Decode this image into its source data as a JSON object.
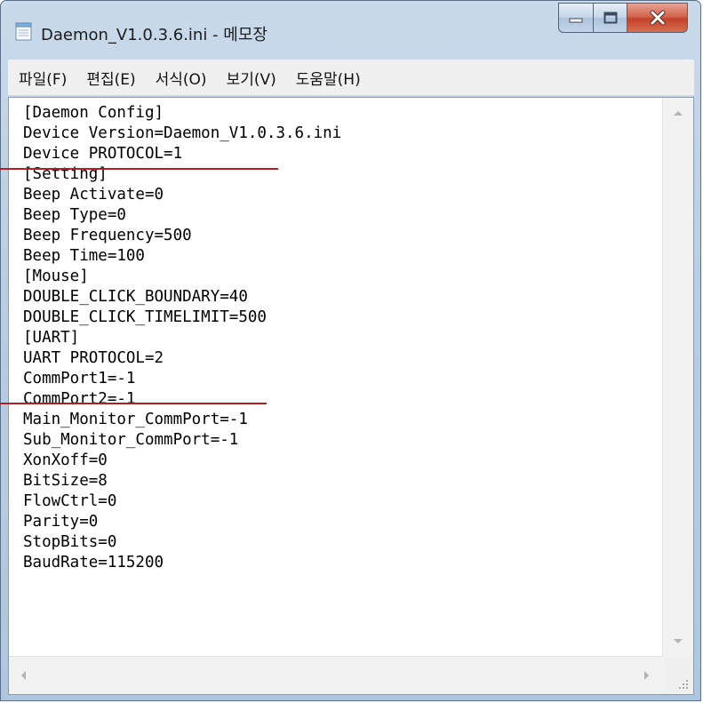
{
  "window": {
    "title": "Daemon_V1.0.3.6.ini - 메모장",
    "app_icon": "notepad-icon",
    "buttons": {
      "minimize": "minimize-icon",
      "maximize": "maximize-icon",
      "close": "close-icon"
    }
  },
  "menu": [
    {
      "label": "파일(F)"
    },
    {
      "label": "편집(E)"
    },
    {
      "label": "서식(O)"
    },
    {
      "label": "보기(V)"
    },
    {
      "label": "도움말(H)"
    }
  ],
  "content": {
    "lines": [
      "[Daemon Config]",
      "Device Version=Daemon_V1.0.3.6.ini",
      "Device PROTOCOL=1",
      "[Setting]",
      "Beep Activate=0",
      "Beep Type=0",
      "Beep Frequency=500",
      "Beep Time=100",
      "[Mouse]",
      "DOUBLE_CLICK_BOUNDARY=40",
      "DOUBLE_CLICK_TIMELIMIT=500",
      "[UART]",
      "UART PROTOCOL=2",
      "CommPort1=-1",
      "CommPort2=-1",
      "Main_Monitor_CommPort=-1",
      "Sub_Monitor_CommPort=-1",
      "XonXoff=0",
      "BitSize=8",
      "FlowCtrl=0",
      "Parity=0",
      "StopBits=0",
      "BaudRate=115200"
    ]
  },
  "annotations": {
    "color": "#b02020"
  },
  "colors": {
    "close_button": "#c4402a",
    "titlebar": "#b9cee4"
  }
}
